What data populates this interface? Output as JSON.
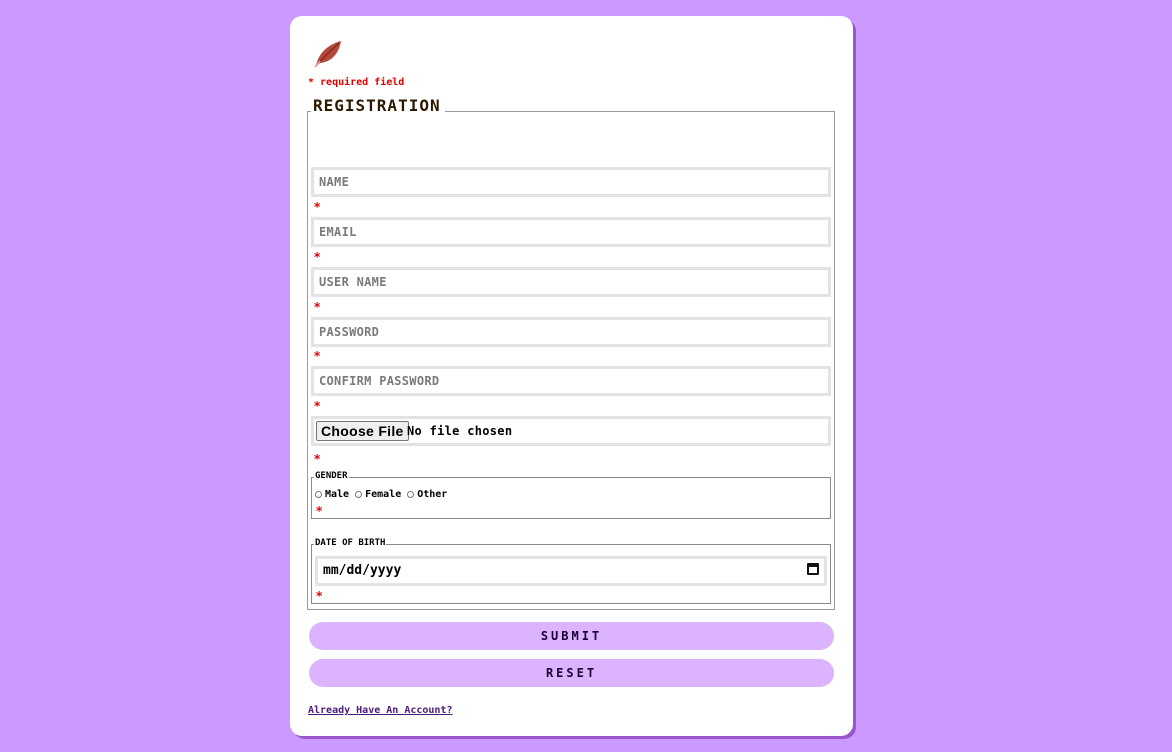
{
  "form": {
    "required_note": "* required field",
    "title": "REGISTRATION",
    "required_star": "*",
    "fields": {
      "name": {
        "placeholder": "NAME"
      },
      "email": {
        "placeholder": "EMAIL"
      },
      "username": {
        "placeholder": "USER NAME"
      },
      "password": {
        "placeholder": "PASSWORD"
      },
      "confirm_password": {
        "placeholder": "CONFIRM PASSWORD"
      },
      "file": {
        "button_label": "Choose File",
        "status": "No file chosen"
      }
    },
    "gender": {
      "legend": "GENDER",
      "options": [
        "Male",
        "Female",
        "Other"
      ]
    },
    "dob": {
      "legend": "DATE OF BIRTH",
      "placeholder": "mm/dd/yyyy"
    },
    "submit_label": "SUBMIT",
    "reset_label": "RESET",
    "login_link": "Already Have An Account?"
  },
  "colors": {
    "background": "#cc99ff",
    "button": "#dcb3ff",
    "required": "#e00000",
    "logo_leaf": "#b5483a"
  },
  "icons": {
    "logo": "leaf-icon",
    "date_picker": "calendar-icon"
  }
}
